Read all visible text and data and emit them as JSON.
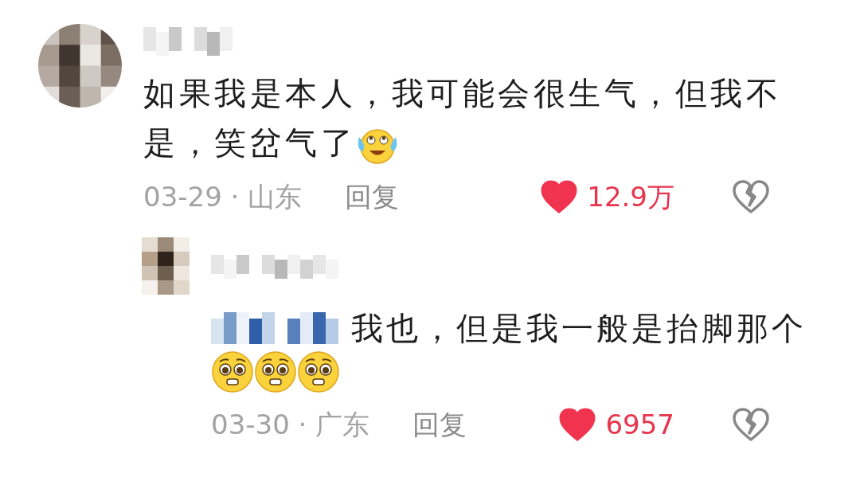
{
  "comments": [
    {
      "text": "如果我是本人，我可能会很生气，但我不是，笑岔气了",
      "emojis": [
        {
          "kind": "tears-of-joy"
        }
      ],
      "meta": "03-29 · 山东",
      "reply_label": "回复",
      "likes": "12.9万",
      "liked": true,
      "disliked": false,
      "replies": [
        {
          "text": "我也，但是我一般是抬脚那个",
          "emojis": [
            {
              "kind": "pleading"
            },
            {
              "kind": "pleading"
            },
            {
              "kind": "pleading"
            }
          ],
          "meta": "03-30 · 广东",
          "reply_label": "回复",
          "likes": "6957",
          "liked": true,
          "disliked": false
        }
      ]
    }
  ]
}
